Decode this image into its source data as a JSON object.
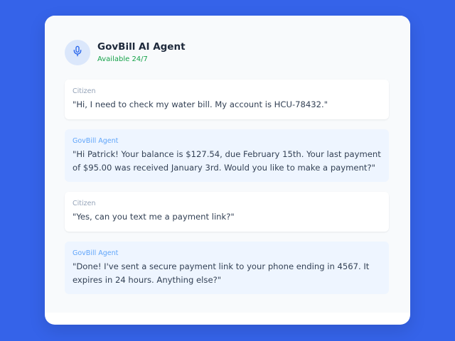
{
  "header": {
    "icon": "microphone-icon",
    "name": "GovBill AI Agent",
    "status": "Available 24/7"
  },
  "messages": [
    {
      "sender": "Citizen",
      "text": "\"Hi, I need to check my water bill. My account is HCU-78432.\""
    },
    {
      "sender": "GovBill Agent",
      "text": "\"Hi Patrick! Your balance is $127.54, due February 15th. Your last payment of $95.00 was received January 3rd. Would you like to make a payment?\""
    },
    {
      "sender": "Citizen",
      "text": "\"Yes, can you text me a payment link?\""
    },
    {
      "sender": "GovBill Agent",
      "text": "\"Done! I've sent a secure payment link to your phone ending in 4567. It expires in 24 hours. Anything else?\""
    }
  ],
  "colors": {
    "background": "#3563e9",
    "accent": "#2563eb",
    "status": "#16a34a",
    "agent_bubble": "#eef5ff"
  }
}
